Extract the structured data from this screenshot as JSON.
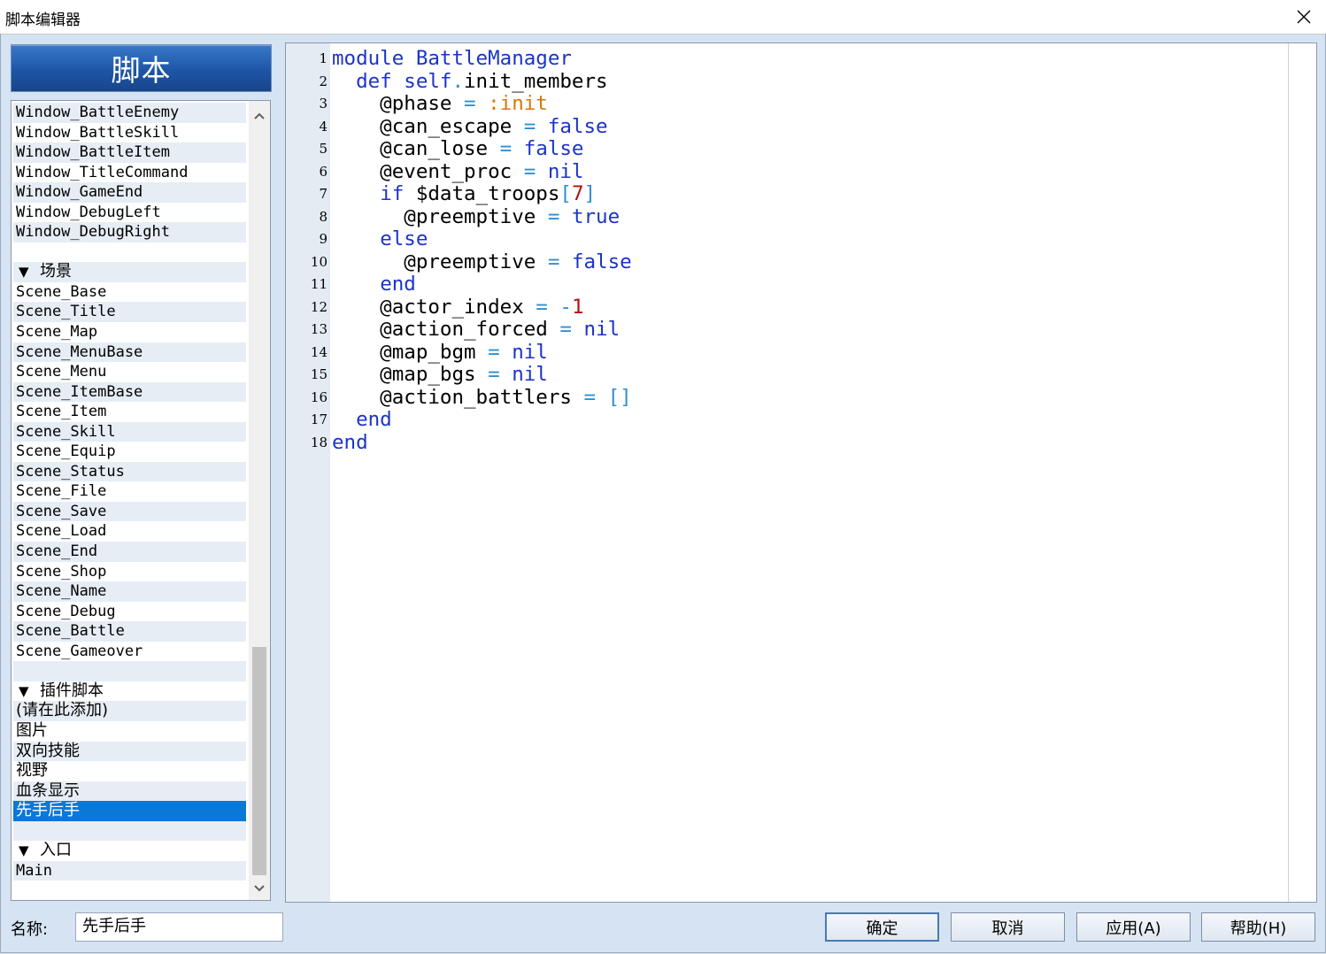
{
  "window": {
    "title": "脚本编辑器"
  },
  "sidebar": {
    "header": "脚本",
    "rows": [
      {
        "text": "Window_BattleEnemy",
        "kind": "item"
      },
      {
        "text": "Window_BattleSkill",
        "kind": "item"
      },
      {
        "text": "Window_BattleItem",
        "kind": "item"
      },
      {
        "text": "Window_TitleCommand",
        "kind": "item"
      },
      {
        "text": "Window_GameEnd",
        "kind": "item"
      },
      {
        "text": "Window_DebugLeft",
        "kind": "item"
      },
      {
        "text": "Window_DebugRight",
        "kind": "item"
      },
      {
        "text": "",
        "kind": "blank"
      },
      {
        "text": "场景",
        "kind": "section"
      },
      {
        "text": "Scene_Base",
        "kind": "item"
      },
      {
        "text": "Scene_Title",
        "kind": "item"
      },
      {
        "text": "Scene_Map",
        "kind": "item"
      },
      {
        "text": "Scene_MenuBase",
        "kind": "item"
      },
      {
        "text": "Scene_Menu",
        "kind": "item"
      },
      {
        "text": "Scene_ItemBase",
        "kind": "item"
      },
      {
        "text": "Scene_Item",
        "kind": "item"
      },
      {
        "text": "Scene_Skill",
        "kind": "item"
      },
      {
        "text": "Scene_Equip",
        "kind": "item"
      },
      {
        "text": "Scene_Status",
        "kind": "item"
      },
      {
        "text": "Scene_File",
        "kind": "item"
      },
      {
        "text": "Scene_Save",
        "kind": "item"
      },
      {
        "text": "Scene_Load",
        "kind": "item"
      },
      {
        "text": "Scene_End",
        "kind": "item"
      },
      {
        "text": "Scene_Shop",
        "kind": "item"
      },
      {
        "text": "Scene_Name",
        "kind": "item"
      },
      {
        "text": "Scene_Debug",
        "kind": "item"
      },
      {
        "text": "Scene_Battle",
        "kind": "item"
      },
      {
        "text": "Scene_Gameover",
        "kind": "item"
      },
      {
        "text": "",
        "kind": "blank"
      },
      {
        "text": "插件脚本",
        "kind": "section"
      },
      {
        "text": "(请在此添加)",
        "kind": "cjk"
      },
      {
        "text": "图片",
        "kind": "cjk"
      },
      {
        "text": "双向技能",
        "kind": "cjk"
      },
      {
        "text": "视野",
        "kind": "cjk"
      },
      {
        "text": "血条显示",
        "kind": "cjk"
      },
      {
        "text": "先手后手",
        "kind": "cjk",
        "selected": true
      },
      {
        "text": "",
        "kind": "blank"
      },
      {
        "text": "入口",
        "kind": "section"
      },
      {
        "text": "Main",
        "kind": "item"
      }
    ]
  },
  "editor": {
    "lines": [
      {
        "n": "1",
        "tokens": [
          [
            "kw",
            "module"
          ],
          [
            "id",
            " "
          ],
          [
            "kw",
            "BattleManager"
          ]
        ]
      },
      {
        "n": "2",
        "tokens": [
          [
            "id",
            "  "
          ],
          [
            "kw",
            "def"
          ],
          [
            "id",
            " "
          ],
          [
            "kw",
            "self"
          ],
          [
            "op",
            "."
          ],
          [
            "id",
            "init_members"
          ]
        ]
      },
      {
        "n": "3",
        "tokens": [
          [
            "id",
            "    @phase "
          ],
          [
            "op",
            "="
          ],
          [
            "id",
            " "
          ],
          [
            "sym",
            ":init"
          ]
        ]
      },
      {
        "n": "4",
        "tokens": [
          [
            "id",
            "    @can_escape "
          ],
          [
            "op",
            "="
          ],
          [
            "id",
            " "
          ],
          [
            "kw",
            "false"
          ]
        ]
      },
      {
        "n": "5",
        "tokens": [
          [
            "id",
            "    @can_lose "
          ],
          [
            "op",
            "="
          ],
          [
            "id",
            " "
          ],
          [
            "kw",
            "false"
          ]
        ]
      },
      {
        "n": "6",
        "tokens": [
          [
            "id",
            "    @event_proc "
          ],
          [
            "op",
            "="
          ],
          [
            "id",
            " "
          ],
          [
            "kw",
            "nil"
          ]
        ]
      },
      {
        "n": "7",
        "tokens": [
          [
            "id",
            "    "
          ],
          [
            "kw",
            "if"
          ],
          [
            "id",
            " $data_troops"
          ],
          [
            "op",
            "["
          ],
          [
            "num",
            "7"
          ],
          [
            "op",
            "]"
          ]
        ]
      },
      {
        "n": "8",
        "tokens": [
          [
            "id",
            "      @preemptive "
          ],
          [
            "op",
            "="
          ],
          [
            "id",
            " "
          ],
          [
            "kw",
            "true"
          ]
        ]
      },
      {
        "n": "9",
        "tokens": [
          [
            "id",
            "    "
          ],
          [
            "kw",
            "else"
          ]
        ]
      },
      {
        "n": "10",
        "tokens": [
          [
            "id",
            "      @preemptive "
          ],
          [
            "op",
            "="
          ],
          [
            "id",
            " "
          ],
          [
            "kw",
            "false"
          ]
        ]
      },
      {
        "n": "11",
        "tokens": [
          [
            "id",
            "    "
          ],
          [
            "kw",
            "end"
          ]
        ]
      },
      {
        "n": "12",
        "tokens": [
          [
            "id",
            "    @actor_index "
          ],
          [
            "op",
            "="
          ],
          [
            "id",
            " "
          ],
          [
            "op",
            "-"
          ],
          [
            "num",
            "1"
          ]
        ]
      },
      {
        "n": "13",
        "tokens": [
          [
            "id",
            "    @action_forced "
          ],
          [
            "op",
            "="
          ],
          [
            "id",
            " "
          ],
          [
            "kw",
            "nil"
          ]
        ]
      },
      {
        "n": "14",
        "tokens": [
          [
            "id",
            "    @map_bgm "
          ],
          [
            "op",
            "="
          ],
          [
            "id",
            " "
          ],
          [
            "kw",
            "nil"
          ]
        ]
      },
      {
        "n": "15",
        "tokens": [
          [
            "id",
            "    @map_bgs "
          ],
          [
            "op",
            "="
          ],
          [
            "id",
            " "
          ],
          [
            "kw",
            "nil"
          ]
        ]
      },
      {
        "n": "16",
        "tokens": [
          [
            "id",
            "    @action_battlers "
          ],
          [
            "op",
            "="
          ],
          [
            "id",
            " "
          ],
          [
            "op",
            "[]"
          ]
        ]
      },
      {
        "n": "17",
        "tokens": [
          [
            "id",
            "  "
          ],
          [
            "kw",
            "end"
          ]
        ]
      },
      {
        "n": "18",
        "tokens": [
          [
            "kw",
            "end"
          ]
        ]
      }
    ]
  },
  "footer": {
    "name_label": "名称:",
    "name_value": "先手后手",
    "ok": "确定",
    "cancel": "取消",
    "apply": "应用(A)",
    "help": "帮助(H)"
  },
  "icons": {
    "close": "close-icon",
    "scroll_up": "chevron-up-icon",
    "scroll_down": "chevron-down-icon",
    "collapse": "triangle-down-icon"
  }
}
